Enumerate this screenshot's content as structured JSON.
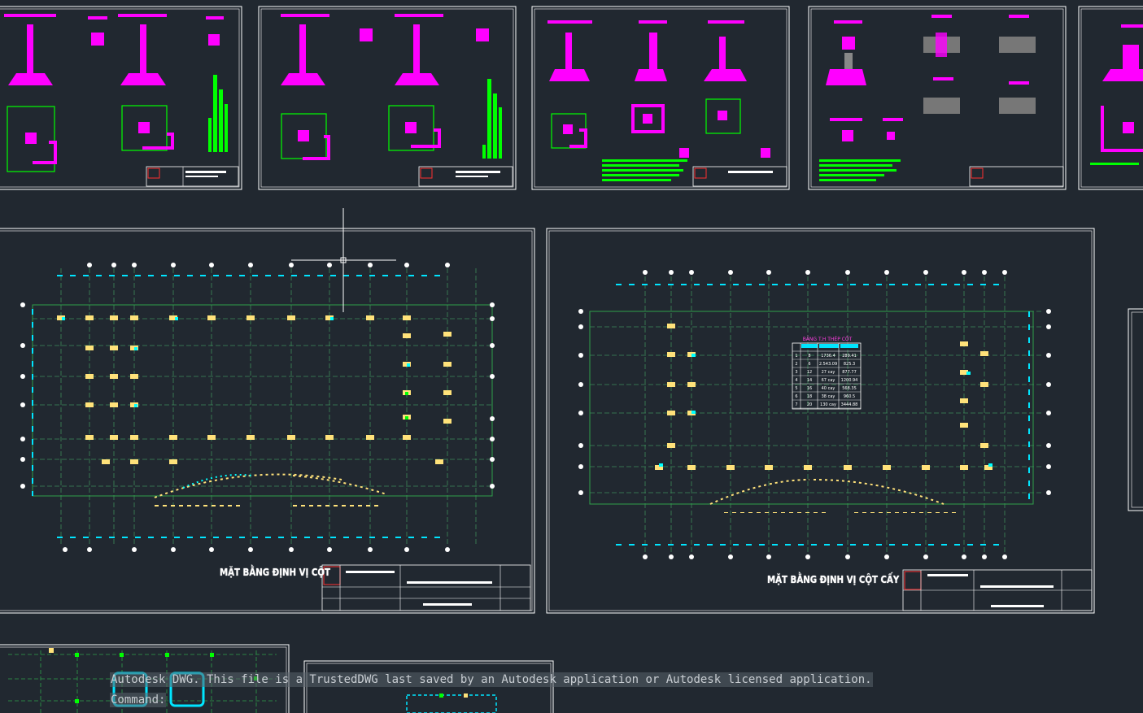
{
  "app": {
    "name": "Autodesk DWG viewer",
    "background": "#212830"
  },
  "command_line": {
    "history": "Autodesk DWG.  This file is a TrustedDWG last saved by an Autodesk application or Autodesk licensed application.",
    "prompt": "Command:"
  },
  "drawings": {
    "plan_1_title": "MẶT BẰNG ĐỊNH VỊ CỘT",
    "plan_2_title": "MẶT BẰNG ĐỊNH VỊ CỘT CẤY",
    "table_title": "BẢNG T.H THÉP CỘT",
    "steel_table": {
      "rows": [
        [
          "1",
          "8",
          "1736.4",
          "289.41"
        ],
        [
          "2",
          "6",
          "2.543.09",
          "825.3"
        ],
        [
          "3",
          "12",
          "27 cay",
          "877.77"
        ],
        [
          "4",
          "14",
          "67 cay",
          "1200.94"
        ],
        [
          "5",
          "16",
          "40 cay",
          "568.35"
        ],
        [
          "6",
          "18",
          "38 cay",
          "960.5"
        ],
        [
          "7",
          "20",
          "130 cay",
          "3444.88"
        ]
      ]
    }
  },
  "colors": {
    "magenta": "#ff00ff",
    "green": "#00ff00",
    "cyan": "#00ffff",
    "yellow": "#ffe27a",
    "white": "#ffffff",
    "grid": "#3c8a5a"
  },
  "icons": {
    "crosshair": "crosshair-cursor-icon"
  }
}
